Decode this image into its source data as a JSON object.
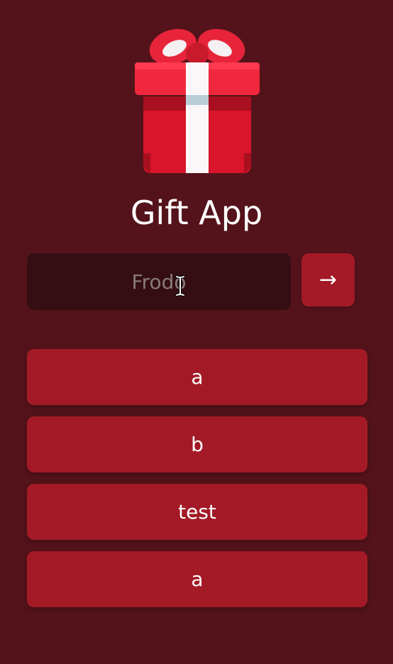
{
  "app": {
    "title": "Gift App",
    "icon": "gift-icon"
  },
  "form": {
    "name_placeholder": "Frodo",
    "name_value": "",
    "submit_label": "→"
  },
  "items": [
    {
      "label": "a"
    },
    {
      "label": "b"
    },
    {
      "label": "test"
    },
    {
      "label": "a"
    }
  ],
  "colors": {
    "background": "#54131a",
    "input_bg": "#340e12",
    "button_bg": "#a31a26",
    "text": "#ffffff"
  }
}
